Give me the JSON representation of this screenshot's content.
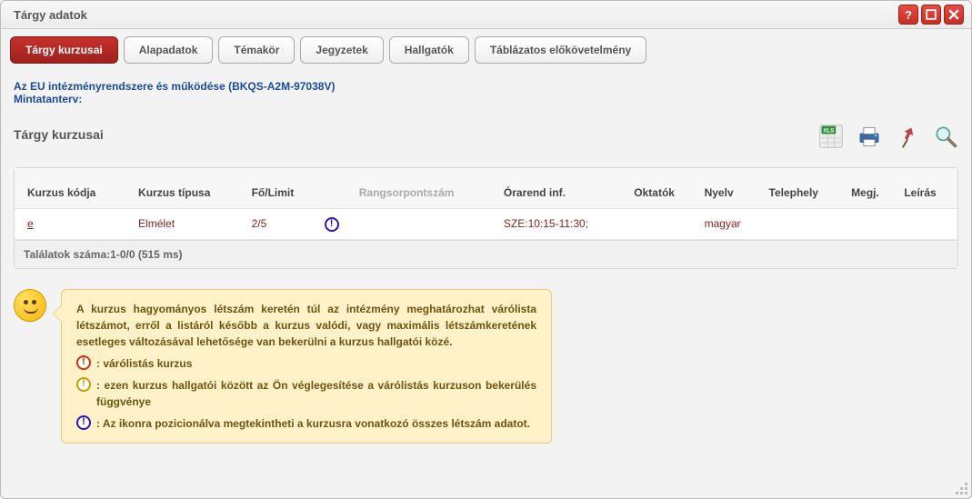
{
  "window": {
    "title": "Tárgy adatok"
  },
  "tabs": [
    {
      "label": "Tárgy kurzusai",
      "active": true
    },
    {
      "label": "Alapadatok"
    },
    {
      "label": "Témakör"
    },
    {
      "label": "Jegyzetek"
    },
    {
      "label": "Hallgatók"
    },
    {
      "label": "Táblázatos előkövetelmény"
    }
  ],
  "subject": {
    "link_text": "Az EU intézményrendszere és működése (BKQS-A2M-97038V)",
    "mintaterv_label": "Mintatanterv:"
  },
  "section": {
    "title": "Tárgy kurzusai"
  },
  "columns": {
    "code": "Kurzus kódja",
    "type": "Kurzus típusa",
    "limit": "Fő/Limit",
    "rank": "Rangsorpontszám",
    "schedule": "Órarend inf.",
    "teachers": "Oktatók",
    "lang": "Nyelv",
    "site": "Telephely",
    "note": "Megj.",
    "desc": "Leírás"
  },
  "rows": [
    {
      "code": "e",
      "type": "Elmélet",
      "limit": "2/5",
      "icon": "blue",
      "schedule": "SZE:10:15-11:30;",
      "teachers": "",
      "lang": "magyar",
      "site": "",
      "note": "",
      "desc": ""
    }
  ],
  "resultbar": "Találatok száma:1-0/0 (515 ms)",
  "hint": {
    "intro": "A kurzus hagyományos létszám keretén túl az intézmény meghatározhat várólista létszámot, erről a listáról később a kurzus valódi, vagy maximális létszámkeretének esetleges változásával lehetősége van bekerülni a kurzus hallgatói közé.",
    "red_text": ": várólistás kurzus",
    "yellow_text": ": ezen kurzus hallgatói között az Ön véglegesítése a várólistás kurzuson bekerülés függvénye",
    "blue_text": ": Az ikonra pozicionálva megtekintheti a kurzusra vonatkozó összes létszám adatot."
  }
}
